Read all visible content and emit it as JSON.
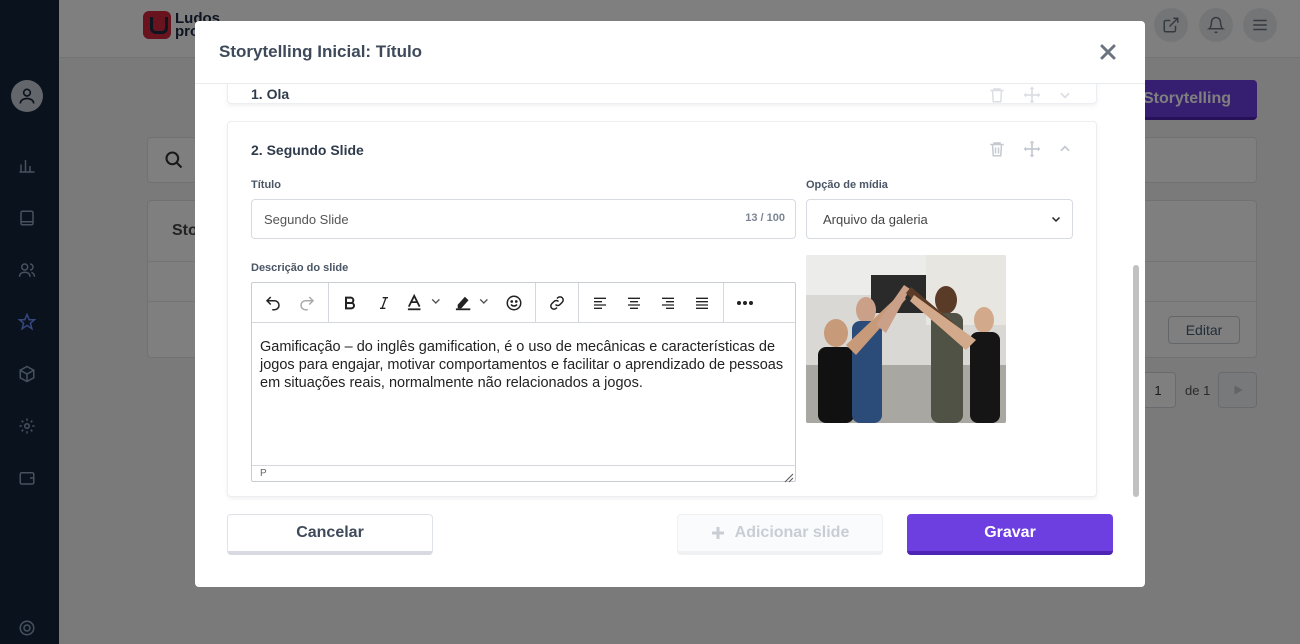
{
  "app": {
    "logo_text_1": "Ludos",
    "logo_text_2": "pro",
    "primary_action_label": "Storytelling",
    "table_header": "Sto",
    "edit_label": "Editar",
    "pager_of": "de 1",
    "pager_current": "1",
    "sidebar_icons": [
      "chart-icon",
      "book-icon",
      "users-icon",
      "star-icon",
      "box-icon",
      "gear-icon",
      "wallet-icon",
      "help-icon"
    ]
  },
  "modal": {
    "title": "Storytelling Inicial: Título",
    "collapsed_slide": {
      "title": "1. Ola"
    },
    "slide": {
      "title": "2. Segundo Slide",
      "title_field_label": "Título",
      "title_value": "Segundo Slide",
      "char_count": "13 / 100",
      "media_label": "Opção de mídia",
      "media_value": "Arquivo da galeria",
      "description_label": "Descrição do slide",
      "description_text": "Gamificação – do inglês gamification, é o uso de mecânicas e características de jogos para engajar, motivar comportamentos e facilitar o aprendizado de pessoas em situações reais, normalmente não relacionados a jogos.",
      "status_path": "P"
    },
    "footer": {
      "cancel_label": "Cancelar",
      "add_label": "Adicionar slide",
      "save_label": "Gravar"
    }
  },
  "colors": {
    "primary": "#6d3fe0",
    "sidebar": "#15263a",
    "accent_red": "#d0263a"
  }
}
